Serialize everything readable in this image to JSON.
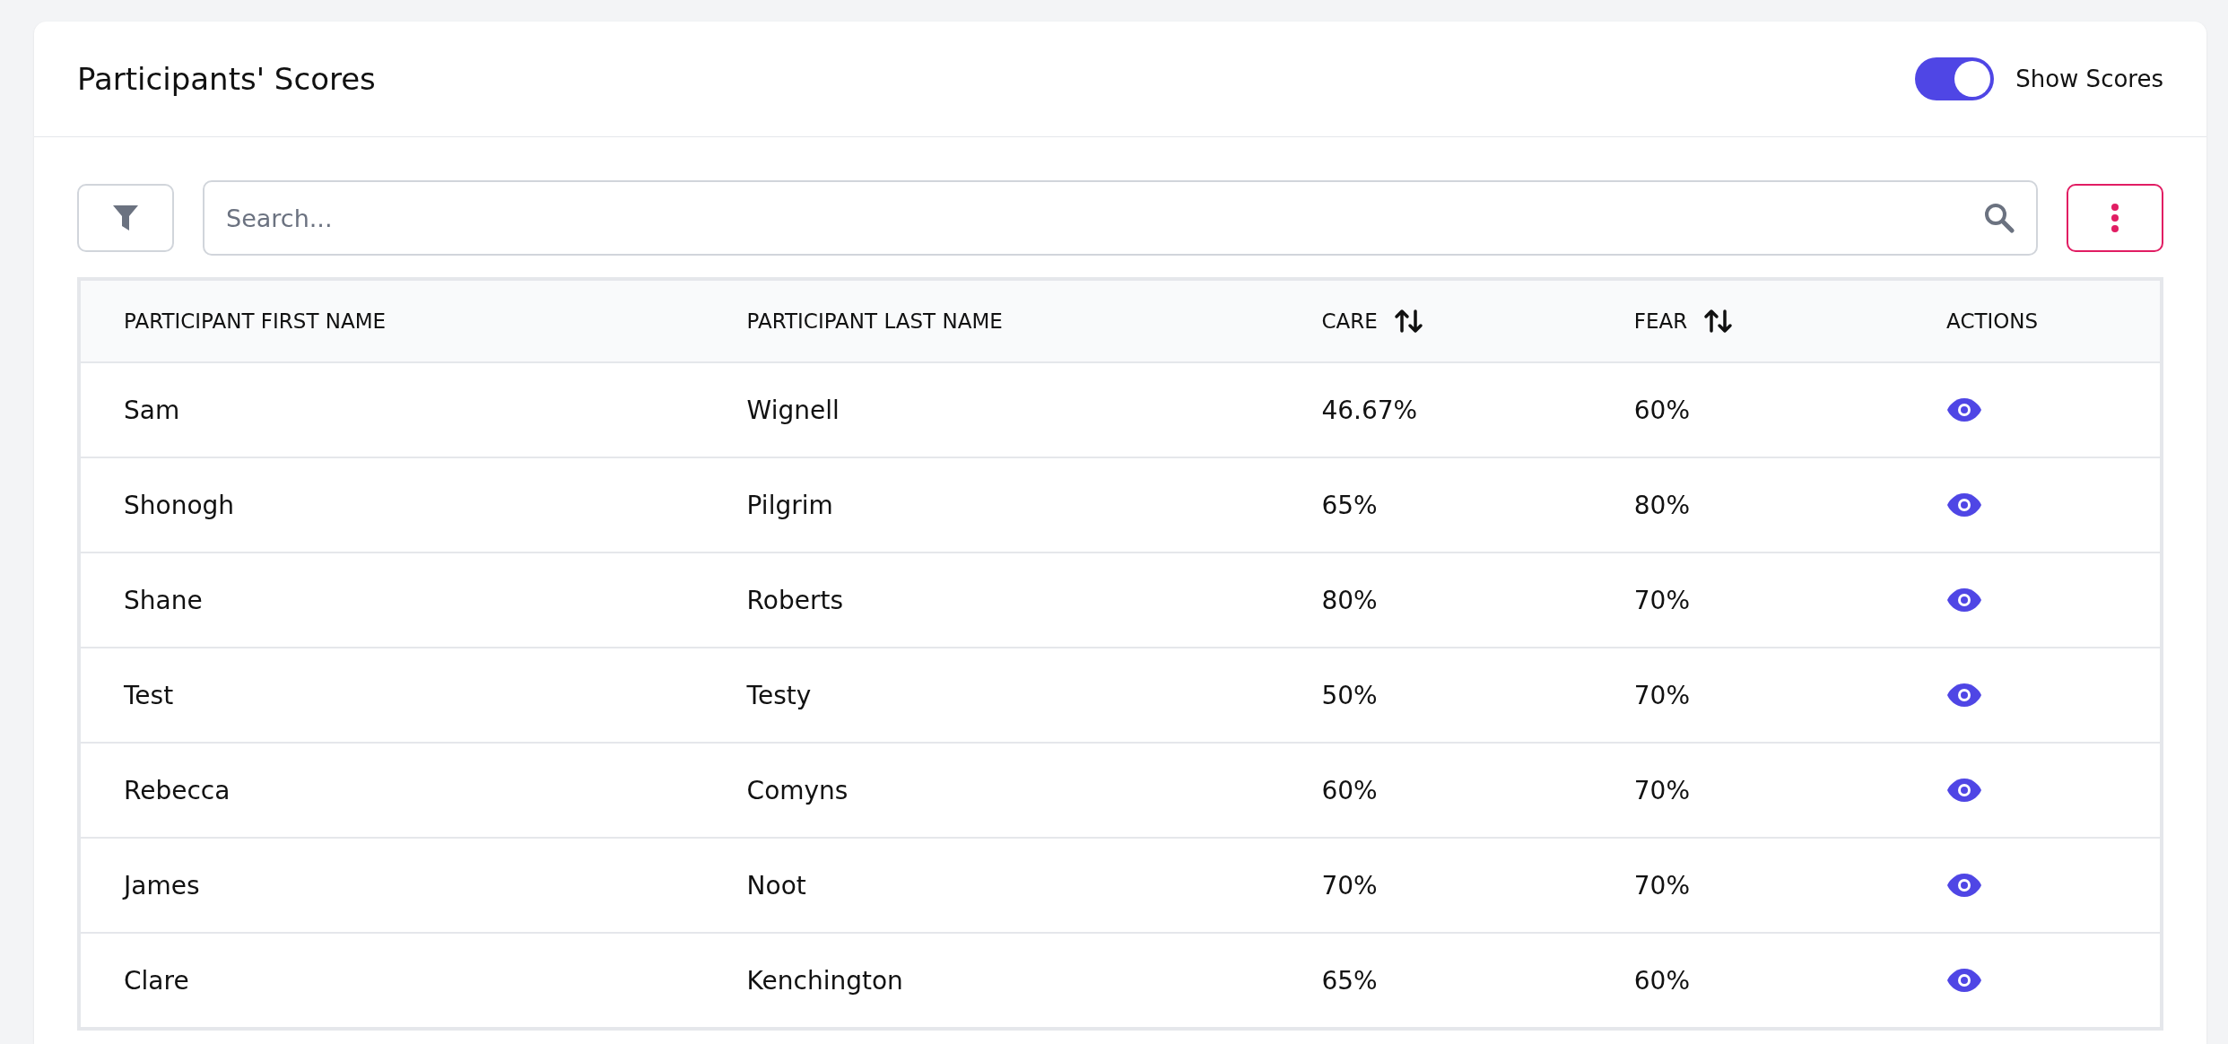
{
  "header": {
    "title": "Participants' Scores",
    "show_scores": {
      "label": "Show Scores",
      "on": true
    }
  },
  "toolbar": {
    "search": {
      "placeholder": "Search..."
    }
  },
  "table": {
    "columns": [
      {
        "label": "PARTICIPANT FIRST NAME",
        "sortable": false
      },
      {
        "label": "PARTICIPANT LAST NAME",
        "sortable": false
      },
      {
        "label": "CARE",
        "sortable": true
      },
      {
        "label": "FEAR",
        "sortable": true
      },
      {
        "label": "ACTIONS",
        "sortable": false
      }
    ],
    "rows": [
      {
        "first_name": "Sam",
        "last_name": "Wignell",
        "care": "46.67%",
        "fear": "60%"
      },
      {
        "first_name": "Shonogh",
        "last_name": "Pilgrim",
        "care": "65%",
        "fear": "80%"
      },
      {
        "first_name": "Shane",
        "last_name": "Roberts",
        "care": "80%",
        "fear": "70%"
      },
      {
        "first_name": "Test",
        "last_name": "Testy",
        "care": "50%",
        "fear": "70%"
      },
      {
        "first_name": "Rebecca",
        "last_name": "Comyns",
        "care": "60%",
        "fear": "70%"
      },
      {
        "first_name": "James",
        "last_name": "Noot",
        "care": "70%",
        "fear": "70%"
      },
      {
        "first_name": "Clare",
        "last_name": "Kenchington",
        "care": "65%",
        "fear": "60%"
      }
    ]
  }
}
